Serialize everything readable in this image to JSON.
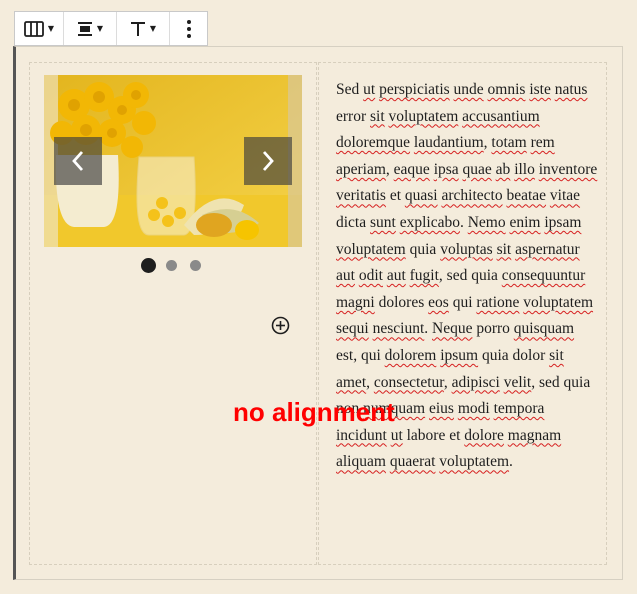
{
  "toolbar": {
    "items": [
      "columns-icon",
      "align-center-icon",
      "align-top-icon",
      "more-options-icon"
    ]
  },
  "slider": {
    "image": "yellow-flowers-still-life",
    "prev": "chevron-left-icon",
    "next": "chevron-right-icon",
    "slide_count": 3,
    "active_slide": 1
  },
  "paragraph": {
    "segments": [
      {
        "t": " Sed ",
        "m": false
      },
      {
        "t": "ut",
        "m": true
      },
      {
        "t": " ",
        "m": false
      },
      {
        "t": "perspiciatis",
        "m": true
      },
      {
        "t": " ",
        "m": false
      },
      {
        "t": "unde",
        "m": true
      },
      {
        "t": " ",
        "m": false
      },
      {
        "t": "omnis",
        "m": true
      },
      {
        "t": " ",
        "m": false
      },
      {
        "t": "iste",
        "m": true
      },
      {
        "t": " ",
        "m": false
      },
      {
        "t": "natus",
        "m": true
      },
      {
        "t": " error ",
        "m": false
      },
      {
        "t": "sit",
        "m": true
      },
      {
        "t": " ",
        "m": false
      },
      {
        "t": "voluptatem",
        "m": true
      },
      {
        "t": " ",
        "m": false
      },
      {
        "t": "accusantium",
        "m": true
      },
      {
        "t": " ",
        "m": false
      },
      {
        "t": "doloremque",
        "m": true
      },
      {
        "t": " ",
        "m": false
      },
      {
        "t": "laudantium",
        "m": true
      },
      {
        "t": ", ",
        "m": false
      },
      {
        "t": "totam",
        "m": true
      },
      {
        "t": " ",
        "m": false
      },
      {
        "t": "rem",
        "m": true
      },
      {
        "t": " ",
        "m": false
      },
      {
        "t": "aperiam",
        "m": true
      },
      {
        "t": ", ",
        "m": false
      },
      {
        "t": "eaque",
        "m": true
      },
      {
        "t": " ",
        "m": false
      },
      {
        "t": "ipsa",
        "m": true
      },
      {
        "t": " ",
        "m": false
      },
      {
        "t": "quae",
        "m": true
      },
      {
        "t": " ",
        "m": false
      },
      {
        "t": "ab",
        "m": true
      },
      {
        "t": "  ",
        "m": false
      },
      {
        "t": "illo",
        "m": true
      },
      {
        "t": " ",
        "m": false
      },
      {
        "t": "inventore",
        "m": true
      },
      {
        "t": " ",
        "m": false
      },
      {
        "t": "veritatis",
        "m": true
      },
      {
        "t": " et ",
        "m": false
      },
      {
        "t": "quasi",
        "m": true
      },
      {
        "t": " ",
        "m": false
      },
      {
        "t": "architecto",
        "m": true
      },
      {
        "t": " ",
        "m": false
      },
      {
        "t": "beatae",
        "m": true
      },
      {
        "t": " ",
        "m": false
      },
      {
        "t": "vitae",
        "m": true
      },
      {
        "t": " dicta ",
        "m": false
      },
      {
        "t": "sunt",
        "m": true
      },
      {
        "t": "  ",
        "m": false
      },
      {
        "t": "explicabo",
        "m": true
      },
      {
        "t": ". ",
        "m": false
      },
      {
        "t": "Nemo",
        "m": true
      },
      {
        "t": " ",
        "m": false
      },
      {
        "t": "enim",
        "m": true
      },
      {
        "t": " ",
        "m": false
      },
      {
        "t": "ipsam",
        "m": true
      },
      {
        "t": " ",
        "m": false
      },
      {
        "t": "voluptatem",
        "m": true
      },
      {
        "t": " quia ",
        "m": false
      },
      {
        "t": "voluptas",
        "m": true
      },
      {
        "t": " ",
        "m": false
      },
      {
        "t": "sit",
        "m": true
      },
      {
        "t": " ",
        "m": false
      },
      {
        "t": "aspernatur",
        "m": true
      },
      {
        "t": " ",
        "m": false
      },
      {
        "t": "aut",
        "m": true
      },
      {
        "t": "  ",
        "m": false
      },
      {
        "t": "odit",
        "m": true
      },
      {
        "t": " ",
        "m": false
      },
      {
        "t": "aut",
        "m": true
      },
      {
        "t": " ",
        "m": false
      },
      {
        "t": "fugit",
        "m": true
      },
      {
        "t": ", sed quia ",
        "m": false
      },
      {
        "t": "consequuntur",
        "m": true
      },
      {
        "t": " ",
        "m": false
      },
      {
        "t": "magni",
        "m": true
      },
      {
        "t": " dolores ",
        "m": false
      },
      {
        "t": "eos",
        "m": true
      },
      {
        "t": " qui ",
        "m": false
      },
      {
        "t": "ratione",
        "m": true
      },
      {
        "t": "  ",
        "m": false
      },
      {
        "t": "voluptatem",
        "m": true
      },
      {
        "t": " ",
        "m": false
      },
      {
        "t": "sequi",
        "m": true
      },
      {
        "t": " ",
        "m": false
      },
      {
        "t": "nesciunt",
        "m": true
      },
      {
        "t": ". ",
        "m": false
      },
      {
        "t": "Neque",
        "m": true
      },
      {
        "t": " porro ",
        "m": false
      },
      {
        "t": "quisquam",
        "m": true
      },
      {
        "t": " est, qui ",
        "m": false
      },
      {
        "t": "dolorem",
        "m": true
      },
      {
        "t": " ",
        "m": false
      },
      {
        "t": "ipsum",
        "m": true
      },
      {
        "t": " quia dolor ",
        "m": false
      },
      {
        "t": "sit",
        "m": true
      },
      {
        "t": " ",
        "m": false
      },
      {
        "t": "amet",
        "m": true
      },
      {
        "t": ", ",
        "m": false
      },
      {
        "t": "consectetur",
        "m": true
      },
      {
        "t": ", ",
        "m": false
      },
      {
        "t": "adipisci",
        "m": true
      },
      {
        "t": " ",
        "m": false
      },
      {
        "t": "velit",
        "m": true
      },
      {
        "t": ", sed quia non ",
        "m": false
      },
      {
        "t": "numquam",
        "m": true
      },
      {
        "t": " ",
        "m": false
      },
      {
        "t": "eius",
        "m": true
      },
      {
        "t": " ",
        "m": false
      },
      {
        "t": "modi",
        "m": true
      },
      {
        "t": " ",
        "m": false
      },
      {
        "t": "tempora",
        "m": true
      },
      {
        "t": " ",
        "m": false
      },
      {
        "t": "incidunt",
        "m": true
      },
      {
        "t": " ",
        "m": false
      },
      {
        "t": "ut",
        "m": true
      },
      {
        "t": " labore et ",
        "m": false
      },
      {
        "t": "dolore",
        "m": true
      },
      {
        "t": " ",
        "m": false
      },
      {
        "t": "magnam",
        "m": true
      },
      {
        "t": " ",
        "m": false
      },
      {
        "t": "aliquam",
        "m": true
      },
      {
        "t": " ",
        "m": false
      },
      {
        "t": "quaerat",
        "m": true
      },
      {
        "t": "  ",
        "m": false
      },
      {
        "t": "voluptatem",
        "m": true
      },
      {
        "t": ".",
        "m": false
      }
    ]
  },
  "overlay": {
    "label": "no alignment",
    "color": "#ff0000"
  },
  "colors": {
    "background": "#f4ecdc",
    "spellcheck": "#d62020"
  }
}
